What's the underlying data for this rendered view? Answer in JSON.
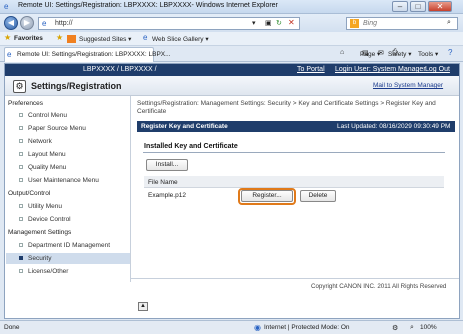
{
  "window": {
    "title": "Remote UI: Settings/Registration: LBPXXXX: LBPXXXX- Windows Internet Explorer"
  },
  "nav": {
    "back_icon": "back-arrow-icon",
    "forward_icon": "forward-arrow-icon",
    "url": "http://",
    "search_placeholder": "Bing"
  },
  "favorites_bar": {
    "favorites": "Favorites",
    "suggested": "Suggested Sites ▾",
    "web_slice": "Web Slice Gallery ▾"
  },
  "tab": {
    "title": "Remote UI: Settings/Registration: LBPXXXX: LBPX..."
  },
  "command_bar": {
    "page": "Page ▾",
    "safety": "Safety ▾",
    "tools": "Tools ▾"
  },
  "header": {
    "device": "LBPXXXX / LBPXXXX /",
    "to_portal": "To Portal",
    "login_user": "Login User: System Manager",
    "log_out": "Log Out",
    "settings_title": "Settings/Registration",
    "mail": "Mail to System Manager"
  },
  "sidebar": {
    "preferences": "Preferences",
    "preferences_items": [
      "Control Menu",
      "Paper Source Menu",
      "Network",
      "Layout Menu",
      "Quality Menu",
      "User Maintenance Menu"
    ],
    "output_control": "Output/Control",
    "output_items": [
      "Utility Menu",
      "Device Control"
    ],
    "management": "Management Settings",
    "management_items": [
      "Department ID Management",
      "Security",
      "License/Other"
    ],
    "selected": "Security"
  },
  "main": {
    "breadcrumb": "Settings/Registration: Management Settings: Security > Key and Certificate Settings > Register Key and Certificate",
    "section_title": "Register Key and Certificate",
    "last_updated": "Last Updated: 08/16/2029 09:30:49 PM",
    "installed_title": "Installed Key and Certificate",
    "install_button": "Install...",
    "column_file_name": "File Name",
    "file_name": "Example.p12",
    "register_button": "Register...",
    "delete_button": "Delete",
    "copyright": "Copyright CANON INC. 2011 All Rights Reserved"
  },
  "statusbar": {
    "left": "Done",
    "zone": "Internet | Protected Mode: On",
    "zoom": "100%"
  }
}
